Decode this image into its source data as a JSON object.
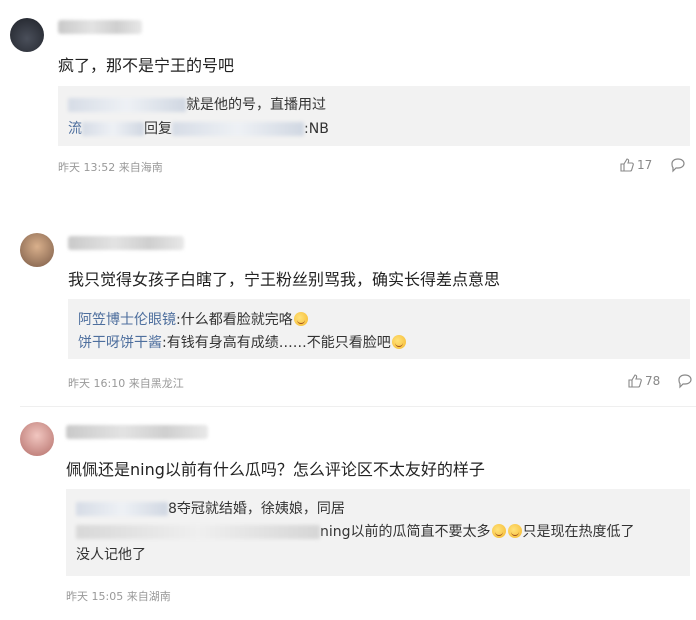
{
  "comments": [
    {
      "text": "疯了，那不是宁王的号吧",
      "replies": [
        {
          "suffix": "就是他的号，直播用过"
        },
        {
          "prefix": "流",
          "mid": "回复",
          "suffix": ":NB"
        }
      ],
      "time": "昨天 13:52 来自海南",
      "likes": "17"
    },
    {
      "text": "我只觉得女孩子白瞎了，宁王粉丝别骂我，确实长得差点意思",
      "replies": [
        {
          "name": "阿笠博士伦眼镜",
          "body": ":什么都看脸就完咯"
        },
        {
          "name": "饼干呀饼干酱",
          "body": ":有钱有身高有成绩……不能只看脸吧"
        }
      ],
      "time": "昨天 16:10 来自黑龙江",
      "likes": "78"
    },
    {
      "text": "佩佩还是ning以前有什么瓜吗？怎么评论区不太友好的样子",
      "replies": [
        {
          "suffix": "8夺冠就结婚，徐姨娘，同居"
        },
        {
          "suffix": "ning以前的瓜简直不要太多",
          "suffix2": "只是现在热度低了",
          "line2": "没人记他了"
        }
      ],
      "time": "昨天 15:05 来自湖南"
    }
  ],
  "icons": {
    "like": "thumbs-up-icon",
    "reply": "comment-bubble-icon",
    "emoji": "smile-emoji"
  },
  "colors": {
    "reply_name": "#4e6f9e",
    "reply_bg": "#f2f2f2",
    "meta": "#999999"
  }
}
